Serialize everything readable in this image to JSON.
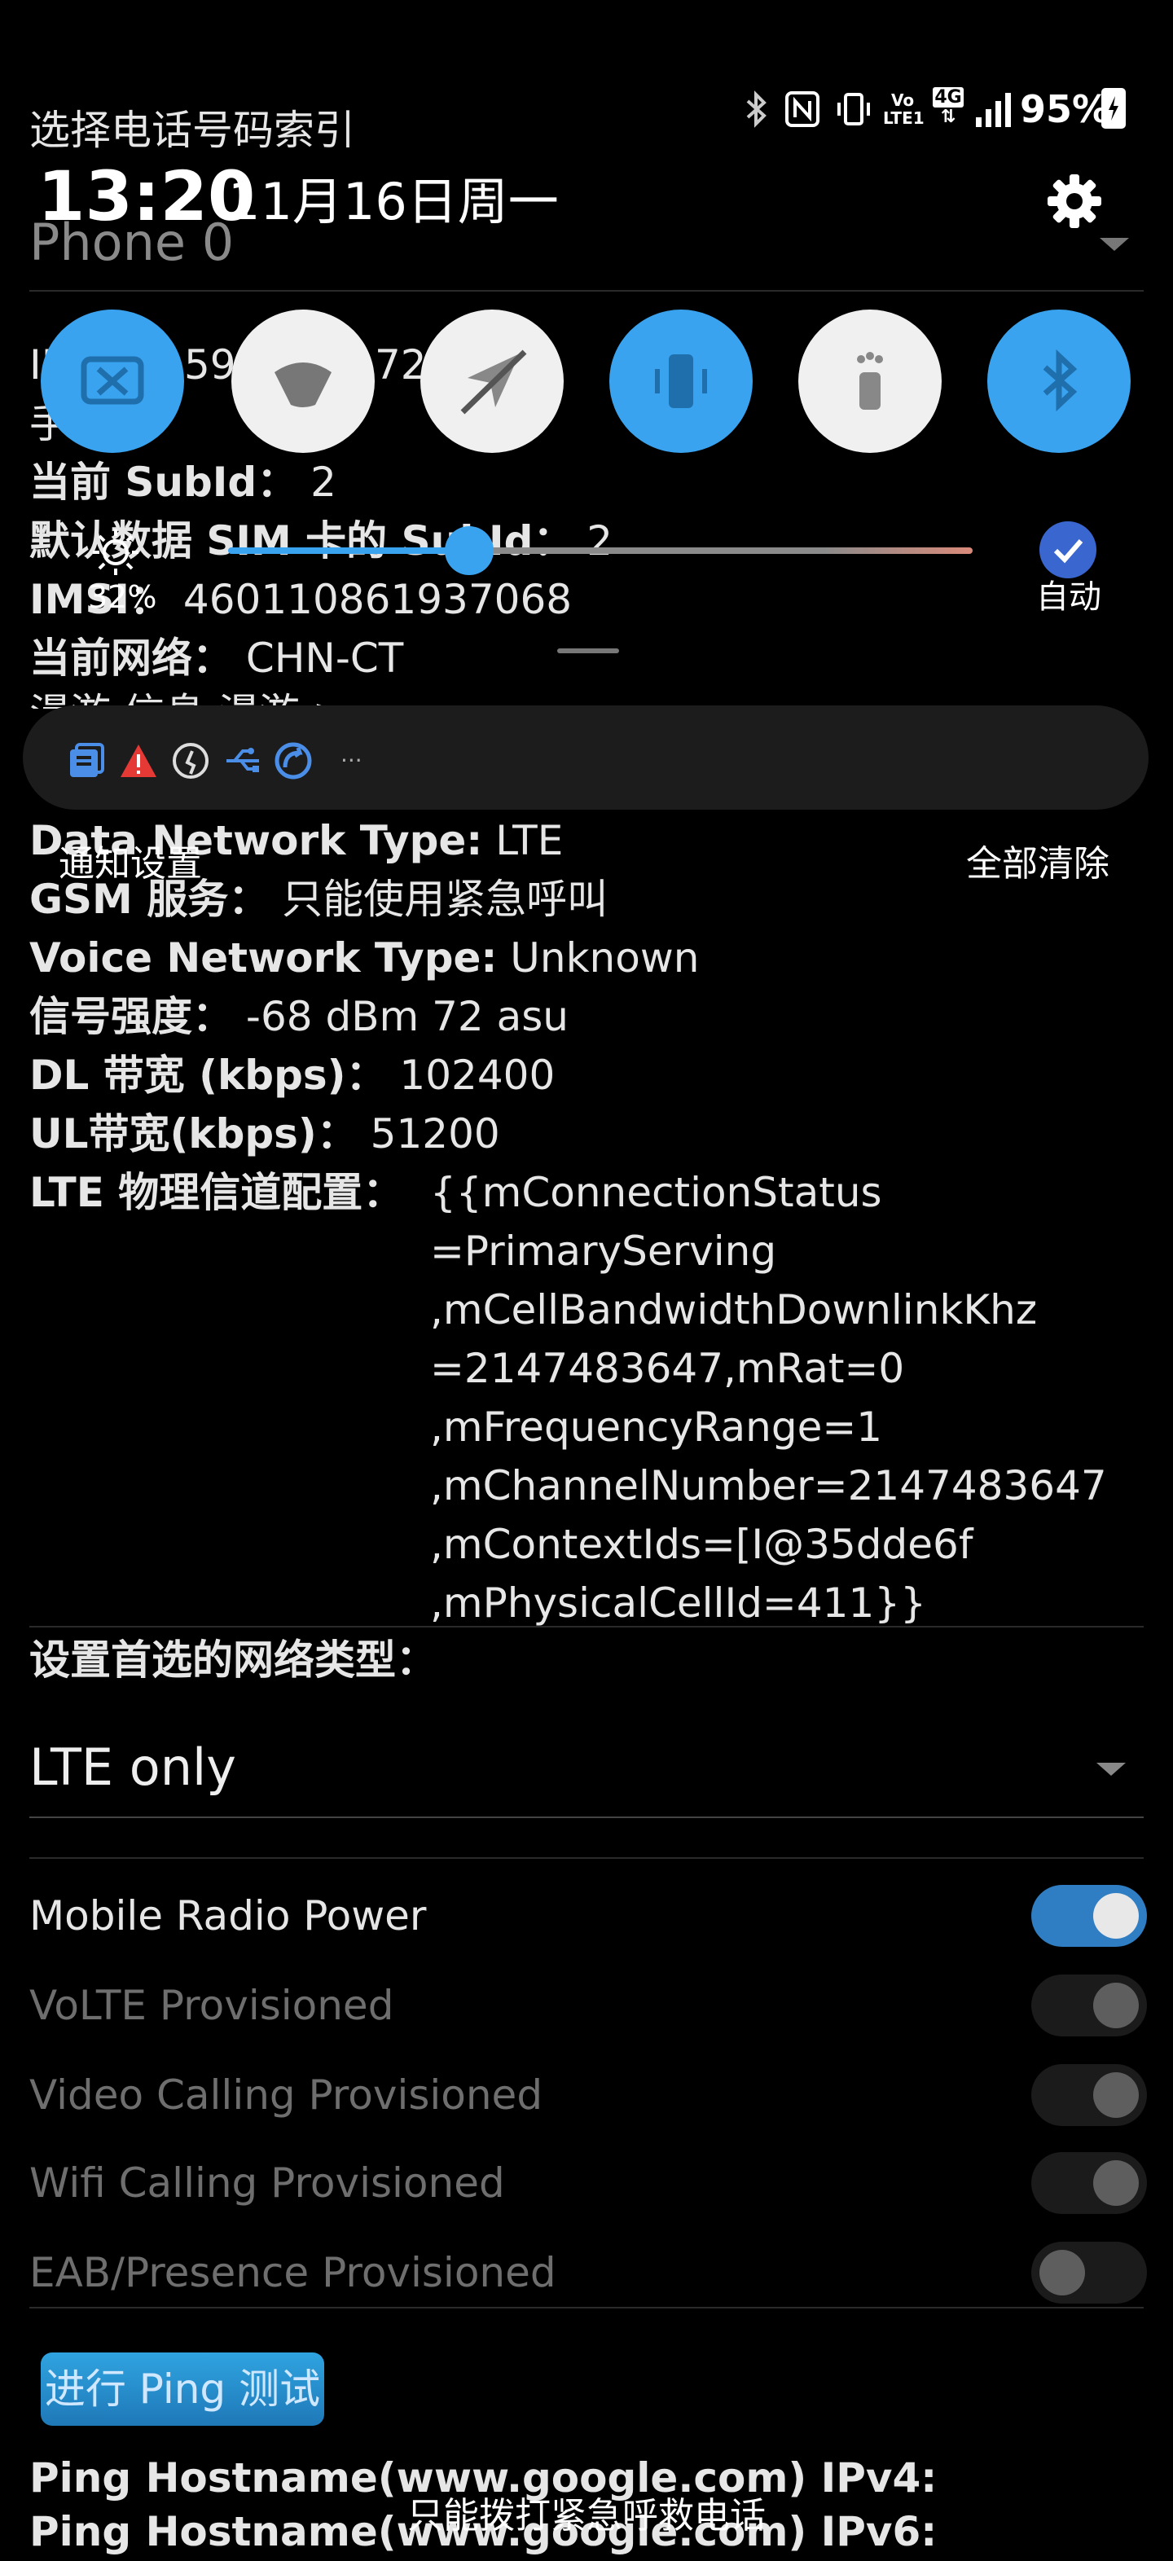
{
  "status_bar": {
    "app_title": "选择电话号码索引",
    "time": "13:20",
    "date": "11月16日周一",
    "battery": "95%",
    "icons": [
      "bluetooth-icon",
      "nfc-icon",
      "vibrate-icon",
      "volte-icon",
      "4g-icon",
      "signal-icon",
      "battery-icon"
    ]
  },
  "phone_selector": {
    "value": "Phone 0"
  },
  "quick_settings": {
    "tiles": [
      {
        "icon": "screencast-icon",
        "on": true
      },
      {
        "icon": "dnd-icon",
        "on": false
      },
      {
        "icon": "location-off-icon",
        "on": false
      },
      {
        "icon": "vibrate-icon",
        "on": true
      },
      {
        "icon": "flashlight-icon",
        "on": false
      },
      {
        "icon": "bluetooth-icon",
        "on": true
      }
    ],
    "brightness": {
      "percent_label": "32%",
      "level": 0.32
    },
    "auto_label": "自动"
  },
  "partial_info": {
    "imei_prefix": "IM",
    "imei_mid": "595",
    "imei_end": "727",
    "phone_prefix": "手",
    "subid_label": "当前 SubId：",
    "subid_value": "2",
    "default_sim_label": "默认数据 SIM 卡的 SubId：",
    "default_sim_value": "2",
    "imsi_label": "IMSI：",
    "imsi_value": "460110861937068",
    "network_label": "当前网络：",
    "network_value": "CHN-CT",
    "roaming_partial": "漫游 信息 漫游 >"
  },
  "notification": {
    "icons": [
      "news-icon",
      "warning-icon",
      "activity-icon",
      "usb-icon",
      "sync-icon"
    ],
    "more": "···",
    "settings_label": "通知设置",
    "clear_all_label": "全部清除"
  },
  "info": {
    "data_network_label": "Data Network Type:",
    "data_network_value": "LTE",
    "gsm_label": "GSM 服务：",
    "gsm_value": "只能使用紧急呼叫",
    "voice_network_label": "Voice Network Type:",
    "voice_network_value": "Unknown",
    "signal_label": "信号强度：",
    "signal_value": "-68 dBm   72 asu",
    "dl_label": "DL 带宽 (kbps)：",
    "dl_value": "102400",
    "ul_label": "UL带宽(kbps)：",
    "ul_value": "51200",
    "lte_phys_label": "LTE 物理信道配置：",
    "lte_phys_lines": [
      "{{mConnectionStatus",
      "=PrimaryServing",
      ",mCellBandwidthDownlinkKhz",
      "=2147483647,mRat=0",
      ",mFrequencyRange=1",
      ",mChannelNumber=2147483647",
      ",mContextIds=[I@35dde6f",
      ",mPhysicalCellId=411}}"
    ]
  },
  "network_type": {
    "label": "设置首选的网络类型：",
    "value": "LTE only"
  },
  "toggles": [
    {
      "label": "Mobile Radio Power",
      "on": true,
      "enabled": true
    },
    {
      "label": "VoLTE Provisioned",
      "on": true,
      "enabled": false
    },
    {
      "label": "Video Calling Provisioned",
      "on": true,
      "enabled": false
    },
    {
      "label": "Wifi Calling Provisioned",
      "on": true,
      "enabled": false
    },
    {
      "label": "EAB/Presence Provisioned",
      "on": false,
      "enabled": false
    }
  ],
  "ping": {
    "button_label": "进行 Ping 测试",
    "ipv4_label": "Ping Hostname(www.google.com) IPv4:",
    "ipv6_label": "Ping Hostname(www.google.com) IPv6:"
  },
  "footer": {
    "emergency_only": "只能拨打紧急呼救电话"
  },
  "colors": {
    "accent": "#3aa3ef",
    "toggle_on": "#2f7dc2",
    "warning": "#e53935",
    "slider_end": "#d98a7a"
  }
}
